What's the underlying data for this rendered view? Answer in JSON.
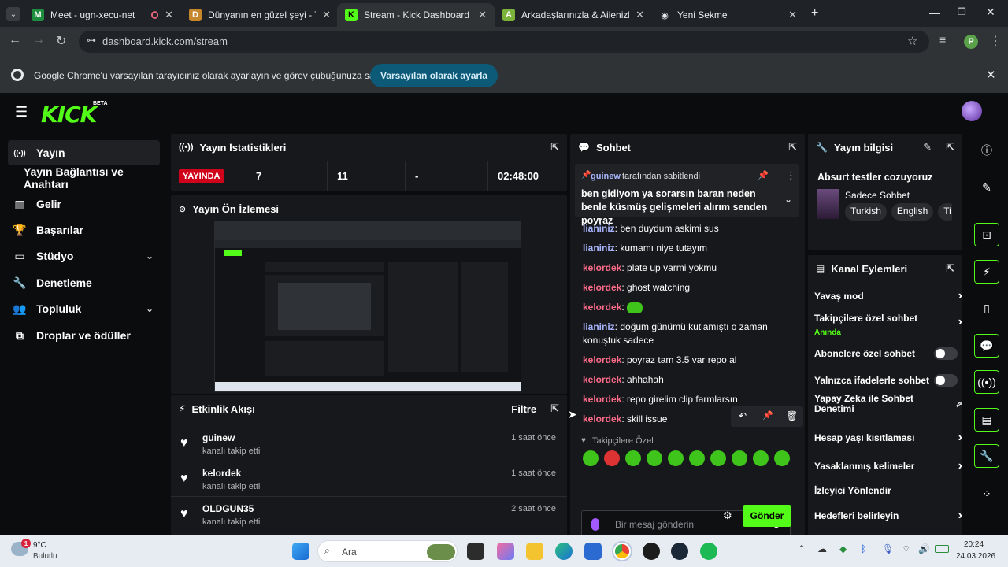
{
  "browser": {
    "tabs": [
      {
        "title": "Meet - ugn-xecu-net",
        "favicon_color": "#1e8e3e",
        "favicon": "M"
      },
      {
        "title": "Dünyanın en güzel şeyi - Tier Li",
        "favicon_color": "#c6862a",
        "favicon": "D"
      },
      {
        "title": "Stream - Kick Dashboard",
        "favicon_color": "#53fc18",
        "favicon": "K"
      },
      {
        "title": "Arkadaşlarınızla & Ailenizle Ücr",
        "favicon_color": "#7bb33a",
        "favicon": "A"
      },
      {
        "title": "Yeni Sekme",
        "favicon_color": "#9aa0a6",
        "favicon": "◉"
      }
    ],
    "url": "dashboard.kick.com/stream",
    "profile_initial": "P",
    "infobar": {
      "message": "Google Chrome'u varsayılan tarayıcınız olarak ayarlayın ve görev çubuğunuza sabitleyin",
      "button": "Varsayılan olarak ayarla"
    }
  },
  "app": {
    "logo": "KICK",
    "beta": "BETA",
    "accent": "#53fc18",
    "sidebar": [
      {
        "label": "Yayın",
        "icon": "broadcast-icon",
        "glyph": "((•))",
        "active": true
      },
      {
        "label": "Yayın Bağlantısı ve Anahtarı",
        "icon": "",
        "glyph": "",
        "active": false
      },
      {
        "label": "Gelir",
        "icon": "chart-icon",
        "glyph": "▥",
        "active": false
      },
      {
        "label": "Başarılar",
        "icon": "trophy-icon",
        "glyph": "🏆",
        "active": false
      },
      {
        "label": "Stüdyo",
        "icon": "studio-icon",
        "glyph": "▭",
        "active": false,
        "chevron": true
      },
      {
        "label": "Denetleme",
        "icon": "wrench-icon",
        "glyph": "🔧",
        "active": false
      },
      {
        "label": "Topluluk",
        "icon": "community-icon",
        "glyph": "👥",
        "active": false,
        "chevron": true
      },
      {
        "label": "Droplar ve ödüller",
        "icon": "drops-icon",
        "glyph": "⧉",
        "active": false
      }
    ],
    "stats": {
      "title": "Yayın İstatistikleri",
      "live": "YAYINDA",
      "values": [
        "7",
        "11",
        "-",
        "02:48:00"
      ]
    },
    "preview": {
      "title": "Yayın Ön İzlemesi"
    },
    "activity": {
      "title": "Etkinlik Akışı",
      "filter": "Filtre",
      "items": [
        {
          "name": "guinew",
          "sub": "kanalı takip etti",
          "time": "1 saat önce"
        },
        {
          "name": "kelordek",
          "sub": "kanalı takip etti",
          "time": "1 saat önce"
        },
        {
          "name": "OLDGUN35",
          "sub": "kanalı takip etti",
          "time": "2 saat önce"
        }
      ]
    },
    "chat": {
      "title": "Sohbet",
      "pinned_by_user": "guinew",
      "pinned_by_suffix": "tarafından sabitlendi",
      "pinned_text": "ben gidiyom ya sorarsın baran neden benle küsmüş gelişmeleri alırım senden poyraz",
      "messages": [
        {
          "user": "lianiniz",
          "color": "blue",
          "text": "ben duydum askimi sus"
        },
        {
          "user": "lianiniz",
          "color": "blue",
          "text": "kumamı niye tutayım"
        },
        {
          "user": "kelordek",
          "color": "pink",
          "text": "plate up varmi yokmu"
        },
        {
          "user": "kelordek",
          "color": "pink",
          "text": "ghost watching"
        },
        {
          "user": "kelordek",
          "color": "pink",
          "text": ""
        },
        {
          "user": "lianiniz",
          "color": "blue",
          "text": "doğum günümü kutlamıştı o zaman konuştuk sadece"
        },
        {
          "user": "kelordek",
          "color": "pink",
          "text": "poyraz tam 3.5 var repo al"
        },
        {
          "user": "kelordek",
          "color": "pink",
          "text": "ahhahah"
        },
        {
          "user": "kelordek",
          "color": "pink",
          "text": "repo girelim clip farmlarsın"
        },
        {
          "user": "kelordek",
          "color": "pink",
          "text": "skill issue"
        }
      ],
      "followers_only": "Takipçilere Özel",
      "placeholder": "Bir mesaj gönderin",
      "send": "Gönder"
    },
    "stream_info": {
      "title": "Yayın bilgisi",
      "stream_title": "Absurt testler cozuyoruz",
      "category": "Sadece Sohbet",
      "tags": [
        "Turkish",
        "English",
        "Ti"
      ]
    },
    "channel_actions": {
      "title": "Kanal Eylemleri",
      "items": [
        {
          "label": "Yavaş mod",
          "type": "arrow"
        },
        {
          "label": "Takipçilere özel sohbet",
          "sub": "Anında",
          "type": "arrow"
        },
        {
          "label": "Abonelere özel sohbet",
          "type": "toggle"
        },
        {
          "label": "Yalnızca ifadelerle sohbet",
          "type": "toggle"
        },
        {
          "label": "Yapay Zeka ile Sohbet Denetimi",
          "type": "external"
        },
        {
          "label": "Hesap yaşı kısıtlaması",
          "type": "arrow"
        },
        {
          "label": "Yasaklanmış kelimeler",
          "type": "arrow"
        },
        {
          "label": "İzleyici Yönlendir",
          "type": "none"
        },
        {
          "label": "Hedefleri belirleyin",
          "type": "arrow"
        }
      ]
    }
  },
  "taskbar": {
    "weather_temp": "9°C",
    "weather_desc": "Bulutlu",
    "weather_badge": "1",
    "search": "Ara",
    "time": "20:24",
    "date": "24.03.2026"
  }
}
